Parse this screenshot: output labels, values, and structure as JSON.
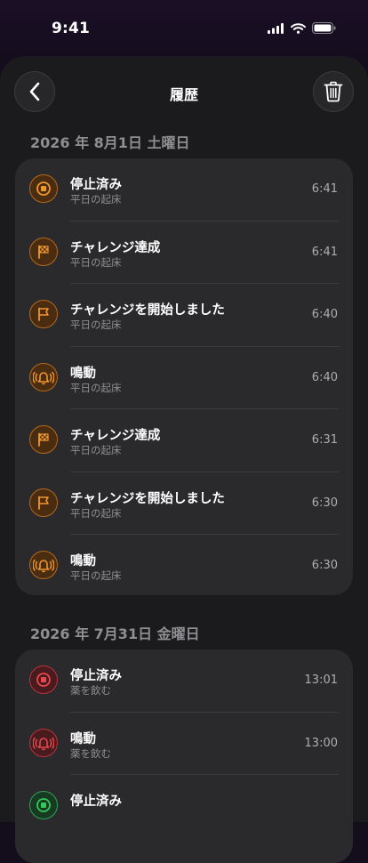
{
  "status_bar": {
    "time": "9:41"
  },
  "header": {
    "title": "履歴"
  },
  "sections": [
    {
      "date": "2026 年 8月1日 土曜日",
      "entries": [
        {
          "title": "停止済み",
          "subtitle": "平日の起床",
          "time": "6:41",
          "icon": "stop-icon",
          "color": "#f0962e"
        },
        {
          "title": "チャレンジ達成",
          "subtitle": "平日の起床",
          "time": "6:41",
          "icon": "checkered-flag-icon",
          "color": "#f0962e"
        },
        {
          "title": "チャレンジを開始しました",
          "subtitle": "平日の起床",
          "time": "6:40",
          "icon": "flag-icon",
          "color": "#f0962e"
        },
        {
          "title": "鳴動",
          "subtitle": "平日の起床",
          "time": "6:40",
          "icon": "ringing-bell-icon",
          "color": "#f0962e"
        },
        {
          "title": "チャレンジ達成",
          "subtitle": "平日の起床",
          "time": "6:31",
          "icon": "checkered-flag-icon",
          "color": "#f0962e"
        },
        {
          "title": "チャレンジを開始しました",
          "subtitle": "平日の起床",
          "time": "6:30",
          "icon": "flag-icon",
          "color": "#f0962e"
        },
        {
          "title": "鳴動",
          "subtitle": "平日の起床",
          "time": "6:30",
          "icon": "ringing-bell-icon",
          "color": "#f0962e"
        }
      ]
    },
    {
      "date": "2026 年 7月31日 金曜日",
      "entries": [
        {
          "title": "停止済み",
          "subtitle": "薬を飲む",
          "time": "13:01",
          "icon": "stop-icon",
          "color": "#e5484d"
        },
        {
          "title": "鳴動",
          "subtitle": "薬を飲む",
          "time": "13:00",
          "icon": "ringing-bell-icon",
          "color": "#e5484d"
        },
        {
          "title": "停止済み",
          "subtitle": "",
          "time": "",
          "icon": "stop-icon",
          "color": "#34c759"
        }
      ]
    }
  ]
}
